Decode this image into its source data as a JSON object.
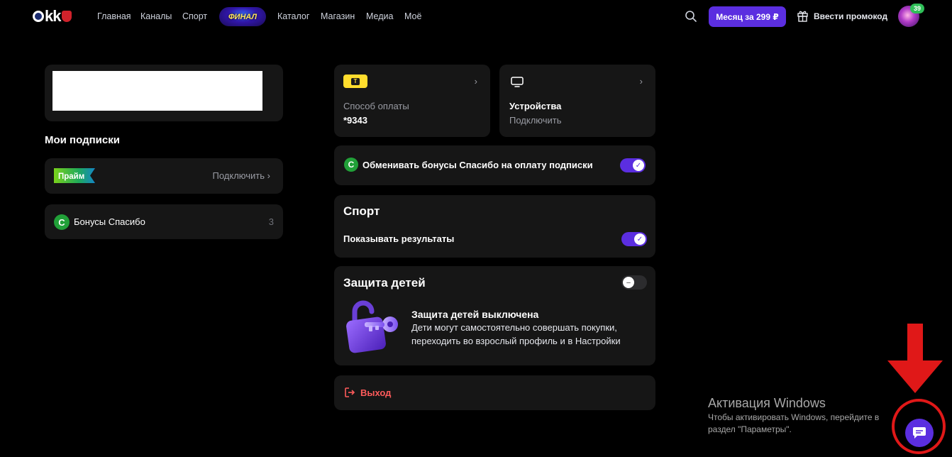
{
  "header": {
    "logo_text": "kk",
    "nav": [
      "Главная",
      "Каналы",
      "Спорт",
      "Каталог",
      "Магазин",
      "Медиа",
      "Моё"
    ],
    "promo_badge": "ФИНАЛ",
    "subscribe_button": "Месяц за 299 ₽",
    "promocode": "Ввести промокод",
    "avatar_badge": "39"
  },
  "left": {
    "subscriptions_title": "Мои подписки",
    "prime_label": "Прайм",
    "prime_action": "Подключить",
    "bonus_label": "Бонусы Спасибо",
    "bonus_count": "3"
  },
  "payment": {
    "label": "Способ оплаты",
    "value": "*9343",
    "icon_letter": "T"
  },
  "devices": {
    "title": "Устройства",
    "action": "Подключить"
  },
  "spasibo": {
    "label": "Обменивать бонусы Спасибо на оплату подписки",
    "enabled": true
  },
  "sport": {
    "title": "Спорт",
    "row_label": "Показывать результаты",
    "enabled": true
  },
  "kids": {
    "title": "Защита детей",
    "status_title": "Защита детей выключена",
    "status_desc": "Дети могут самостоятельно совершать покупки, переходить во взрослый профиль и в Настройки",
    "enabled": false
  },
  "logout": {
    "label": "Выход"
  },
  "watermark": {
    "title": "Активация Windows",
    "line1": "Чтобы активировать Windows, перейдите в",
    "line2": "раздел \"Параметры\"."
  },
  "colors": {
    "accent": "#5b2ee0",
    "danger": "#ff5b5b",
    "sber_green": "#21a038",
    "card_bg": "#161616"
  }
}
